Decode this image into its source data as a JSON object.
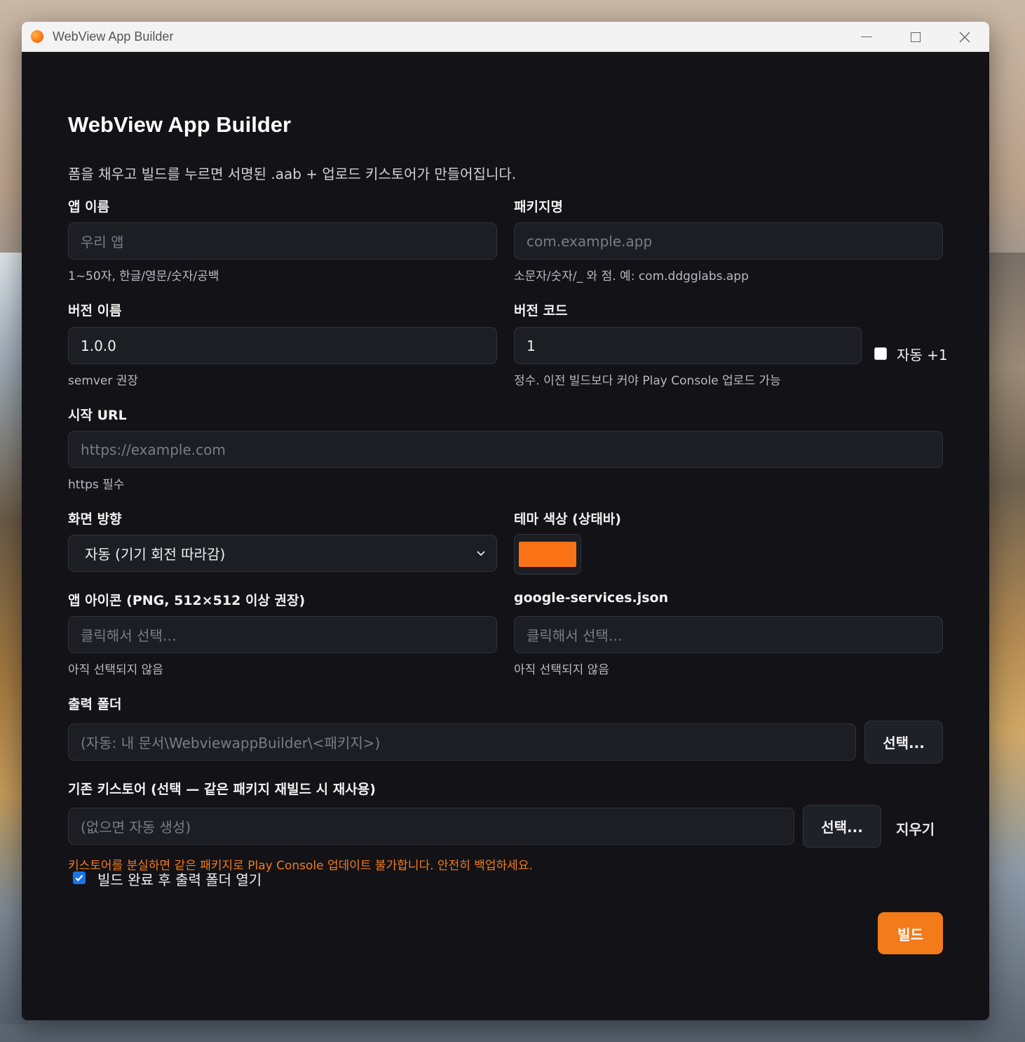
{
  "window": {
    "title": "WebView App Builder"
  },
  "page": {
    "title": "WebView App Builder",
    "subtitle": "폼을 채우고 빌드를 누르면 서명된 .aab + 업로드 키스토어가 만들어집니다."
  },
  "fields": {
    "app_name": {
      "label": "앱 이름",
      "placeholder": "우리 앱",
      "value": "",
      "hint": "1~50자, 한글/영문/숫자/공백"
    },
    "package_name": {
      "label": "패키지명",
      "placeholder": "com.example.app",
      "value": "",
      "hint": "소문자/숫자/_ 와 점. 예: com.ddgglabs.app"
    },
    "version_name": {
      "label": "버전 이름",
      "value": "1.0.0",
      "hint": "semver 권장"
    },
    "version_code": {
      "label": "버전 코드",
      "value": "1",
      "auto_increment_label": "자동 +1",
      "auto_increment_checked": false,
      "hint": "정수. 이전 빌드보다 커야 Play Console 업로드 가능"
    },
    "start_url": {
      "label": "시작 URL",
      "placeholder": "https://example.com",
      "value": "",
      "hint": "https 필수"
    },
    "orientation": {
      "label": "화면 방향",
      "selected": "자동 (기기 회전 따라감)"
    },
    "theme_color": {
      "label": "테마 색상 (상태바)",
      "value": "#f97316"
    },
    "app_icon": {
      "label": "앱 아이콘 (PNG, 512×512 이상 권장)",
      "placeholder": "클릭해서 선택…",
      "hint": "아직 선택되지 않음"
    },
    "google_services": {
      "label": "google-services.json",
      "placeholder": "클릭해서 선택…",
      "hint": "아직 선택되지 않음"
    },
    "output_folder": {
      "label": "출력 폴더",
      "placeholder": "(자동: 내 문서\\WebviewappBuilder\\<패키지>)",
      "button_label": "선택..."
    },
    "keystore": {
      "label": "기존 키스토어 (선택 — 같은 패키지 재빌드 시 재사용)",
      "placeholder": "(없으면 자동 생성)",
      "select_label": "선택...",
      "clear_label": "지우기",
      "warning": "키스토어를 분실하면 같은 패키지로 Play Console 업데이트 불가합니다. 안전히 백업하세요."
    },
    "open_folder": {
      "label": "빌드 완료 후 출력 폴더 열기",
      "checked": true
    }
  },
  "actions": {
    "build_label": "빌드"
  },
  "colors": {
    "accent": "#f47b1a",
    "background": "#121217",
    "input_bg": "#1c1e24",
    "checkbox_blue": "#1a73e8"
  }
}
